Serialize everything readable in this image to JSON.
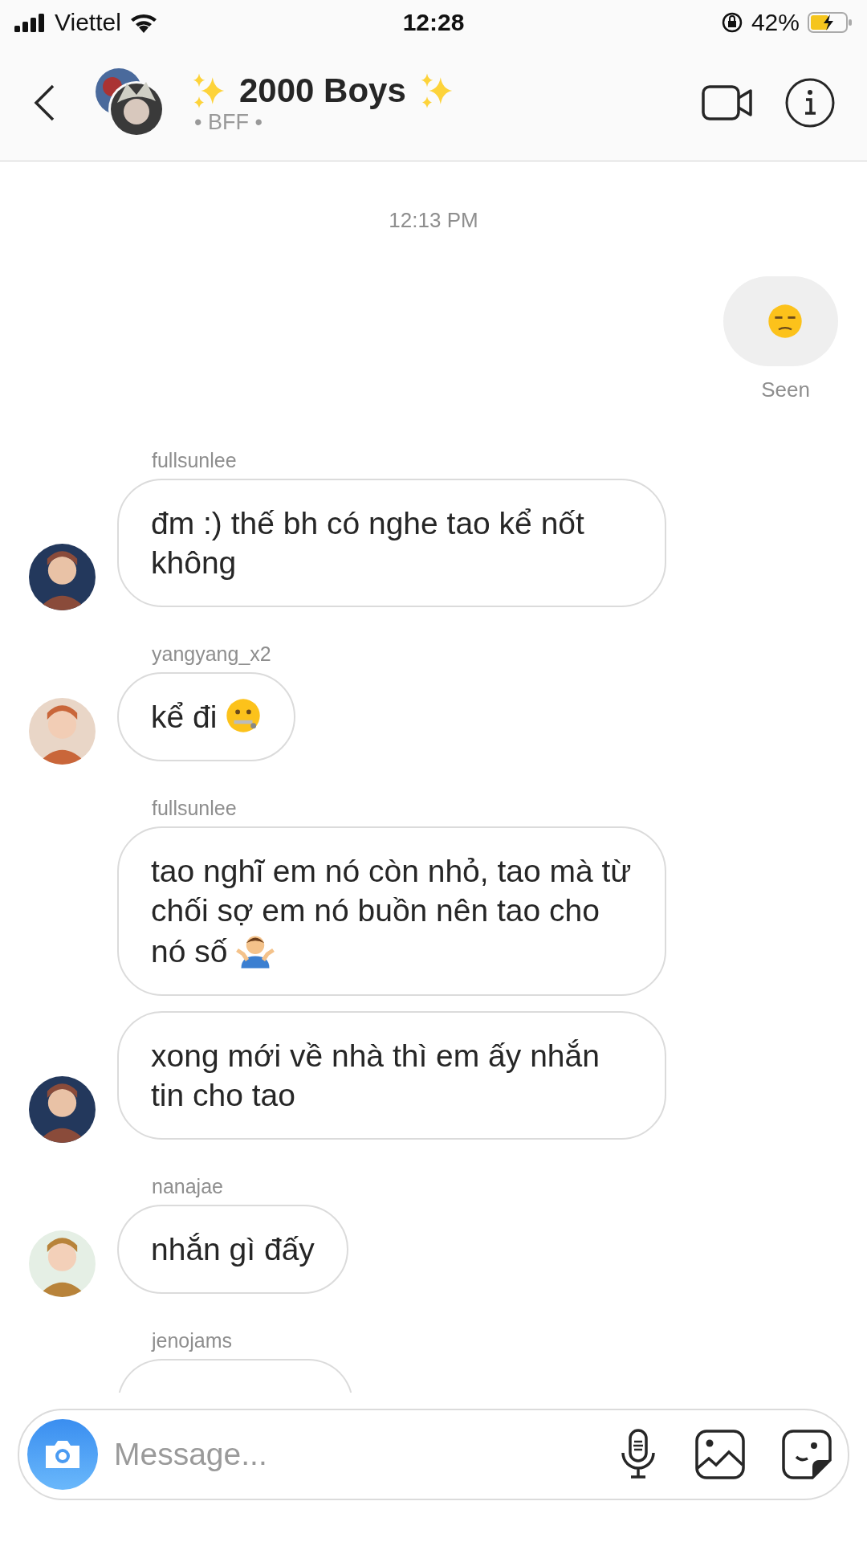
{
  "status_bar": {
    "carrier": "Viettel",
    "time": "12:28",
    "battery": "42%"
  },
  "header": {
    "title": "2000 Boys",
    "subtitle": "• BFF •"
  },
  "timestamp": "12:13 PM",
  "sent": {
    "kind": "unamused",
    "receipt": "Seen"
  },
  "groups": [
    {
      "sender": "fullsunlee",
      "messages": [
        {
          "kind": "plain",
          "text": "đm :) thế bh có nghe tao kể nốt không"
        }
      ]
    },
    {
      "sender": "yangyang_x2",
      "messages": [
        {
          "kind": "zipper",
          "text": "kể đi"
        }
      ]
    },
    {
      "sender": "fullsunlee",
      "messages": [
        {
          "kind": "shrug",
          "text": "tao nghĩ em nó còn nhỏ, tao mà từ chối sợ em nó buồn nên tao cho nó số"
        },
        {
          "kind": "plain",
          "text": "xong mới về nhà thì em ấy nhắn tin cho tao"
        }
      ]
    },
    {
      "sender": "nanajae",
      "messages": [
        {
          "kind": "plain",
          "text": "nhắn gì đấy"
        }
      ]
    },
    {
      "sender": "jenojams",
      "messages": [
        {
          "kind": "cut"
        }
      ]
    }
  ],
  "composer": {
    "placeholder": "Message..."
  }
}
